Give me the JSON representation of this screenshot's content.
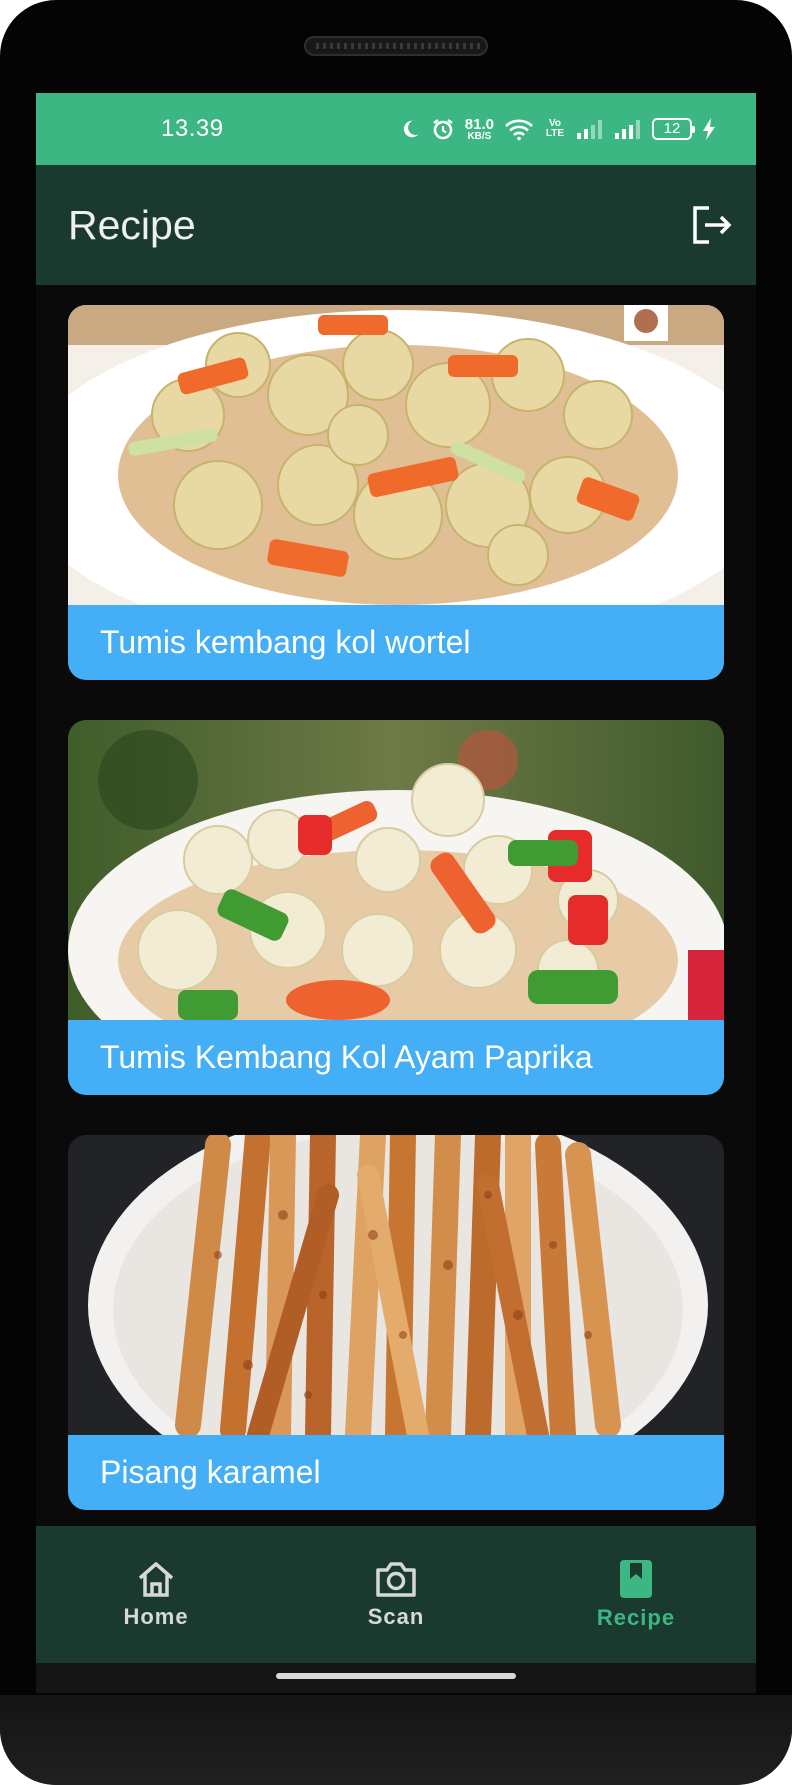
{
  "status_bar": {
    "time": "13.39",
    "net_speed_value": "81.0",
    "net_speed_unit": "KB/S",
    "volte_line1": "Vo",
    "volte_line2": "LTE",
    "battery": "12",
    "color": "#3cb784"
  },
  "app_bar": {
    "title": "Recipe",
    "action_icon": "logout-icon",
    "color": "#1b3a2f"
  },
  "recipes": [
    {
      "title": "Tumis kembang kol wortel",
      "image": "cauliflower-carrot-stir-fry"
    },
    {
      "title": "Tumis Kembang Kol Ayam Paprika",
      "image": "cauliflower-chicken-paprika-bowl"
    },
    {
      "title": "Pisang karamel",
      "image": "caramel-banana-rolls"
    }
  ],
  "bottom_nav": {
    "items": [
      {
        "label": "Home",
        "icon": "home-icon",
        "active": false
      },
      {
        "label": "Scan",
        "icon": "camera-icon",
        "active": false
      },
      {
        "label": "Recipe",
        "icon": "bookmark-book-icon",
        "active": true
      }
    ],
    "active_color": "#3cb784",
    "inactive_color": "#d6d9d8"
  },
  "colors": {
    "caption": "#44aef6",
    "background": "#0a0a0a"
  }
}
